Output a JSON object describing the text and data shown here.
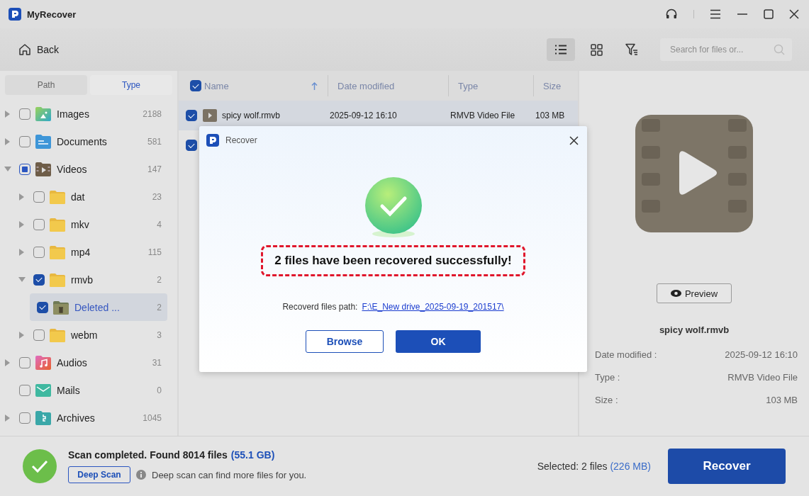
{
  "window": {
    "title": "MyRecover"
  },
  "toolbar": {
    "back": "Back",
    "views": [
      {
        "kind": "list",
        "selected": true
      },
      {
        "kind": "grid",
        "selected": false
      }
    ],
    "search": {
      "placeholder": "Search for files or..."
    }
  },
  "sidebar": {
    "tabs": [
      {
        "label": "Path",
        "selected": false
      },
      {
        "label": "Type",
        "selected": true
      }
    ],
    "tree": [
      {
        "label": "Images",
        "count": "2188",
        "kind": "images",
        "checked": false,
        "indeterminate": false,
        "expandable": true,
        "expanded": false,
        "selected": false
      },
      {
        "label": "Documents",
        "count": "581",
        "kind": "documents",
        "checked": false,
        "indeterminate": false,
        "expandable": true,
        "expanded": false,
        "selected": false
      },
      {
        "label": "Videos",
        "count": "147",
        "kind": "videos",
        "checked": false,
        "indeterminate": true,
        "expandable": true,
        "expanded": true,
        "selected": false,
        "children": [
          {
            "label": "dat",
            "count": "23",
            "kind": "folder",
            "checked": false,
            "indeterminate": false,
            "expandable": true,
            "expanded": false,
            "selected": false
          },
          {
            "label": "mkv",
            "count": "4",
            "kind": "folder",
            "checked": false,
            "indeterminate": false,
            "expandable": true,
            "expanded": false,
            "selected": false
          },
          {
            "label": "mp4",
            "count": "115",
            "kind": "folder",
            "checked": false,
            "indeterminate": false,
            "expandable": true,
            "expanded": false,
            "selected": false
          },
          {
            "label": "rmvb",
            "count": "2",
            "kind": "folder",
            "checked": true,
            "indeterminate": false,
            "expandable": true,
            "expanded": true,
            "selected": false,
            "children": [
              {
                "label": "Deleted ...",
                "count": "2",
                "kind": "deleted",
                "checked": true,
                "indeterminate": false,
                "expandable": false,
                "expanded": false,
                "selected": true
              }
            ]
          },
          {
            "label": "webm",
            "count": "3",
            "kind": "folder",
            "checked": false,
            "indeterminate": false,
            "expandable": true,
            "expanded": false,
            "selected": false
          }
        ]
      },
      {
        "label": "Audios",
        "count": "31",
        "kind": "audios",
        "checked": false,
        "indeterminate": false,
        "expandable": true,
        "expanded": false,
        "selected": false
      },
      {
        "label": "Mails",
        "count": "0",
        "kind": "mails",
        "checked": false,
        "indeterminate": false,
        "expandable": false,
        "expanded": false,
        "selected": false
      },
      {
        "label": "Archives",
        "count": "1045",
        "kind": "archives",
        "checked": false,
        "indeterminate": false,
        "expandable": true,
        "expanded": false,
        "selected": false
      }
    ]
  },
  "table": {
    "all_checked": true,
    "columns": [
      {
        "label": "Name",
        "sorted": true
      },
      {
        "label": "Date modified",
        "sorted": false
      },
      {
        "label": "Type",
        "sorted": false
      },
      {
        "label": "Size",
        "sorted": false
      }
    ],
    "rows": [
      {
        "checked": true,
        "selected": true,
        "name": "spicy wolf.rmvb",
        "date": "2025-09-12 16:10",
        "type": "RMVB Video File",
        "size": "103 MB"
      },
      {
        "checked": true,
        "selected": false
      }
    ]
  },
  "details": {
    "preview_button": "Preview",
    "file_name": "spicy wolf.rmvb",
    "fields": [
      {
        "label": "Date modified :",
        "value": "2025-09-12 16:10"
      },
      {
        "label": "Type :",
        "value": "RMVB Video File"
      },
      {
        "label": "Size :",
        "value": "103 MB"
      }
    ]
  },
  "dialog": {
    "title": "Recover",
    "message": "2 files have been recovered successfully!",
    "path_label": "Recoverd files path:",
    "path": "F:\\E_New drive_2025-09-19_201517\\",
    "buttons": [
      {
        "label": "Browse",
        "kind": "secondary"
      },
      {
        "label": "OK",
        "kind": "primary"
      }
    ]
  },
  "status_bar": {
    "summary": "Scan completed. Found 8014 files",
    "summary_size": "(55.1 GB)",
    "deep_scan": "Deep Scan",
    "hint": "Deep scan can find more files for you.",
    "selected": "Selected: 2 files",
    "selected_size": "(226 MB)",
    "recover": "Recover"
  }
}
